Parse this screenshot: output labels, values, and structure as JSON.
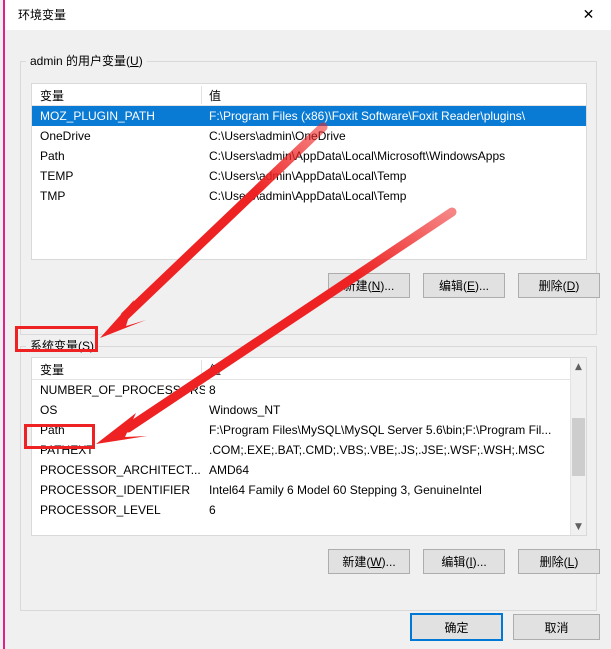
{
  "window": {
    "title": "环境变量",
    "close_icon": "close-icon",
    "accent_color": "#e0218a"
  },
  "user_section": {
    "legend_prefix": "admin 的用户变量(",
    "legend_accel": "U",
    "legend_suffix": ")",
    "columns": [
      "变量",
      "值"
    ],
    "rows": [
      {
        "name": "MOZ_PLUGIN_PATH",
        "value": "F:\\Program Files (x86)\\Foxit Software\\Foxit Reader\\plugins\\",
        "selected": true
      },
      {
        "name": "OneDrive",
        "value": "C:\\Users\\admin\\OneDrive",
        "selected": false
      },
      {
        "name": "Path",
        "value": "C:\\Users\\admin\\AppData\\Local\\Microsoft\\WindowsApps",
        "selected": false
      },
      {
        "name": "TEMP",
        "value": "C:\\Users\\admin\\AppData\\Local\\Temp",
        "selected": false
      },
      {
        "name": "TMP",
        "value": "C:\\Users\\admin\\AppData\\Local\\Temp",
        "selected": false
      }
    ],
    "buttons": [
      {
        "prefix": "新建(",
        "accel": "N",
        "suffix": ")..."
      },
      {
        "prefix": "编辑(",
        "accel": "E",
        "suffix": ")..."
      },
      {
        "prefix": "删除(",
        "accel": "D",
        "suffix": ")"
      }
    ]
  },
  "system_section": {
    "legend_prefix": "系统变量(",
    "legend_accel": "S",
    "legend_suffix": ")",
    "columns": [
      "变量",
      "值"
    ],
    "rows": [
      {
        "name": "NUMBER_OF_PROCESSORS",
        "value": "8"
      },
      {
        "name": "OS",
        "value": "Windows_NT"
      },
      {
        "name": "Path",
        "value": "F:\\Program Files\\MySQL\\MySQL Server 5.6\\bin;F:\\Program Fil..."
      },
      {
        "name": "PATHEXT",
        "value": ".COM;.EXE;.BAT;.CMD;.VBS;.VBE;.JS;.JSE;.WSF;.WSH;.MSC"
      },
      {
        "name": "PROCESSOR_ARCHITECT...",
        "value": "AMD64"
      },
      {
        "name": "PROCESSOR_IDENTIFIER",
        "value": "Intel64 Family 6 Model 60 Stepping 3, GenuineIntel"
      },
      {
        "name": "PROCESSOR_LEVEL",
        "value": "6"
      }
    ],
    "scrollbar": {
      "up_arrow": "▲",
      "down_arrow": "▼"
    },
    "buttons": [
      {
        "prefix": "新建(",
        "accel": "W",
        "suffix": ")..."
      },
      {
        "prefix": "编辑(",
        "accel": "I",
        "suffix": ")..."
      },
      {
        "prefix": "删除(",
        "accel": "L",
        "suffix": ")"
      }
    ]
  },
  "footer": {
    "ok_label": "确定",
    "cancel_label": "取消"
  },
  "annotations": {
    "color": "#ee2222",
    "highlight_system_legend": true,
    "highlight_system_path_row": true,
    "arrow_count": 2
  }
}
